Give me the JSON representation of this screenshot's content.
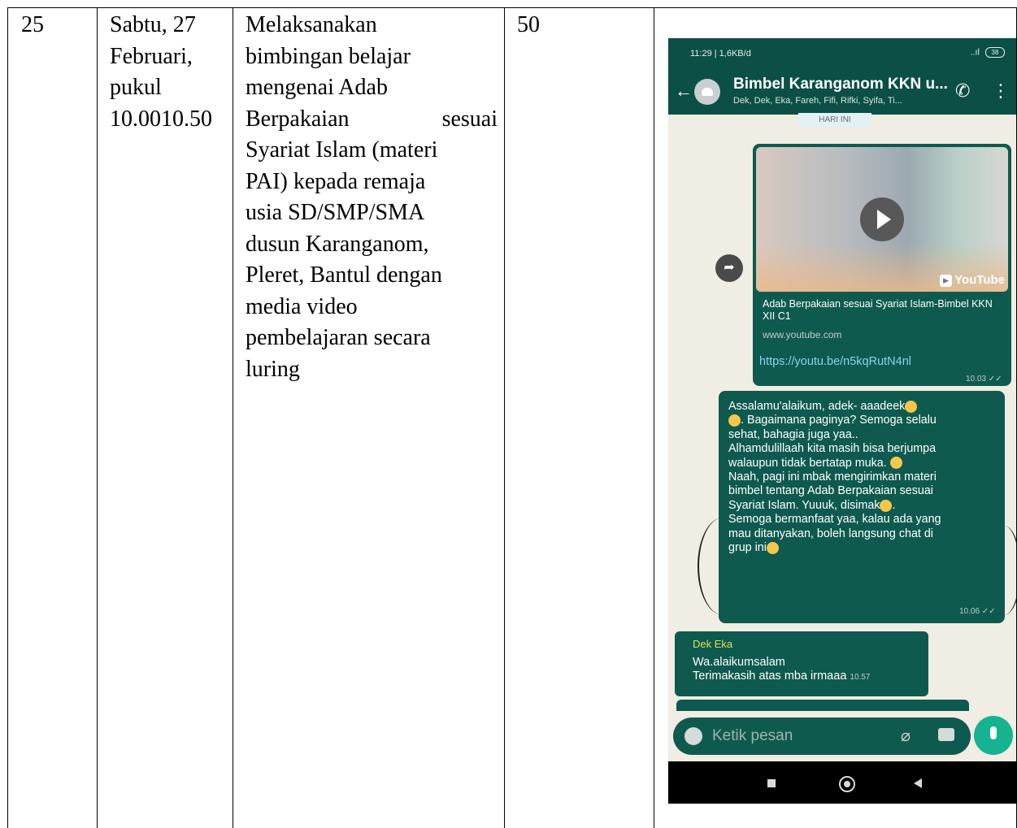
{
  "row": {
    "no": "25",
    "date_lines": [
      "Sabtu, 27",
      "Februari,",
      "pukul",
      "10.0010.50"
    ],
    "activity_lines": [
      "Melaksanakan",
      "bimbingan belajar",
      "mengenai Adab",
      "Berpakaian sesuai",
      "Syariat Islam (materi",
      "PAI) kepada remaja",
      "usia SD/SMP/SMA",
      "dusun Karanganom,",
      "Pleret, Bantul  dengan",
      "media video",
      "pembelajaran secara",
      "luring"
    ],
    "activity_just_left": "Berpakaian",
    "activity_just_right": "sesuai",
    "count": "50"
  },
  "phone": {
    "status_left": "11:29 | 1,6KB/d",
    "status_right": "..ıl",
    "battery": "38",
    "chat_title": "Bimbel Karanganom KKN u...",
    "chat_subtitle": "Dek, Dek, Eka, Fareh, Fifi, Rifki, Syifa, Ti...",
    "date_chip": "HARI INI",
    "link_preview": {
      "title": "Adab Berpakaian sesuai Syariat Islam-Bimbel KKN XII C1",
      "domain": "www.youtube.com",
      "url": "https://youtu.be/n5kqRutN4nl",
      "yt_label": "YouTube",
      "time": "10.03"
    },
    "message": {
      "lines": [
        "Assalamu'alaikum, adek- aaadeek",
        ". Bagaimana paginya? Semoga selalu",
        "sehat, bahagia juga yaa..",
        "Alhamdulillaah kita masih bisa berjumpa",
        "walaupun tidak bertatap muka.",
        "Naah, pagi ini mbak mengirimkan materi",
        "bimbel tentang Adab Berpakaian sesuai",
        "Syariat Islam. Yuuuk, disimak",
        "Semoga bermanfaat yaa, kalau ada yang",
        "mau ditanyakan, boleh langsung chat di",
        "grup ini"
      ],
      "time": "10.06"
    },
    "reply": {
      "sender": "Dek Eka",
      "line1": "Wa.alaikumsalam",
      "line2": "Terimakasih atas mba irmaaa",
      "time": "10.57"
    },
    "input_placeholder": "Ketik pesan"
  }
}
